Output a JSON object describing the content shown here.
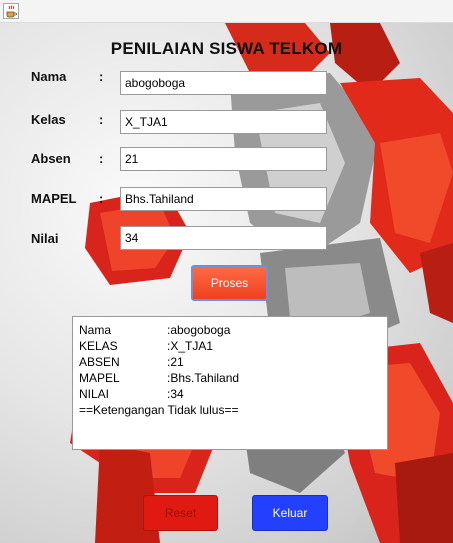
{
  "form": {
    "title": "PENILAIAN SISWA TELKOM",
    "colon": ":",
    "fields": [
      {
        "label": "Nama",
        "value": "abogoboga"
      },
      {
        "label": "Kelas",
        "value": "X_TJA1"
      },
      {
        "label": "Absen",
        "value": "21"
      },
      {
        "label": "MAPEL",
        "value": "Bhs.Tahiland"
      },
      {
        "label": "Nilai",
        "value": "34"
      }
    ]
  },
  "buttons": {
    "proses": "Proses",
    "reset": "Reset",
    "keluar": "Keluar"
  },
  "output": {
    "rows": [
      {
        "key": "Nama",
        "value": ":abogoboga"
      },
      {
        "key": "KELAS",
        "value": ":X_TJA1"
      },
      {
        "key": "ABSEN",
        "value": ":21"
      },
      {
        "key": "MAPEL",
        "value": ":Bhs.Tahiland"
      },
      {
        "key": "NILAI",
        "value": ":34"
      }
    ],
    "note": "==Ketengangan Tidak lulus=="
  },
  "icons": {
    "window": "java-coffee-icon"
  },
  "colors": {
    "proses": "#f0401e",
    "reset": "#e01a12",
    "keluar": "#2440ff",
    "robot_red": "#e8281a"
  }
}
